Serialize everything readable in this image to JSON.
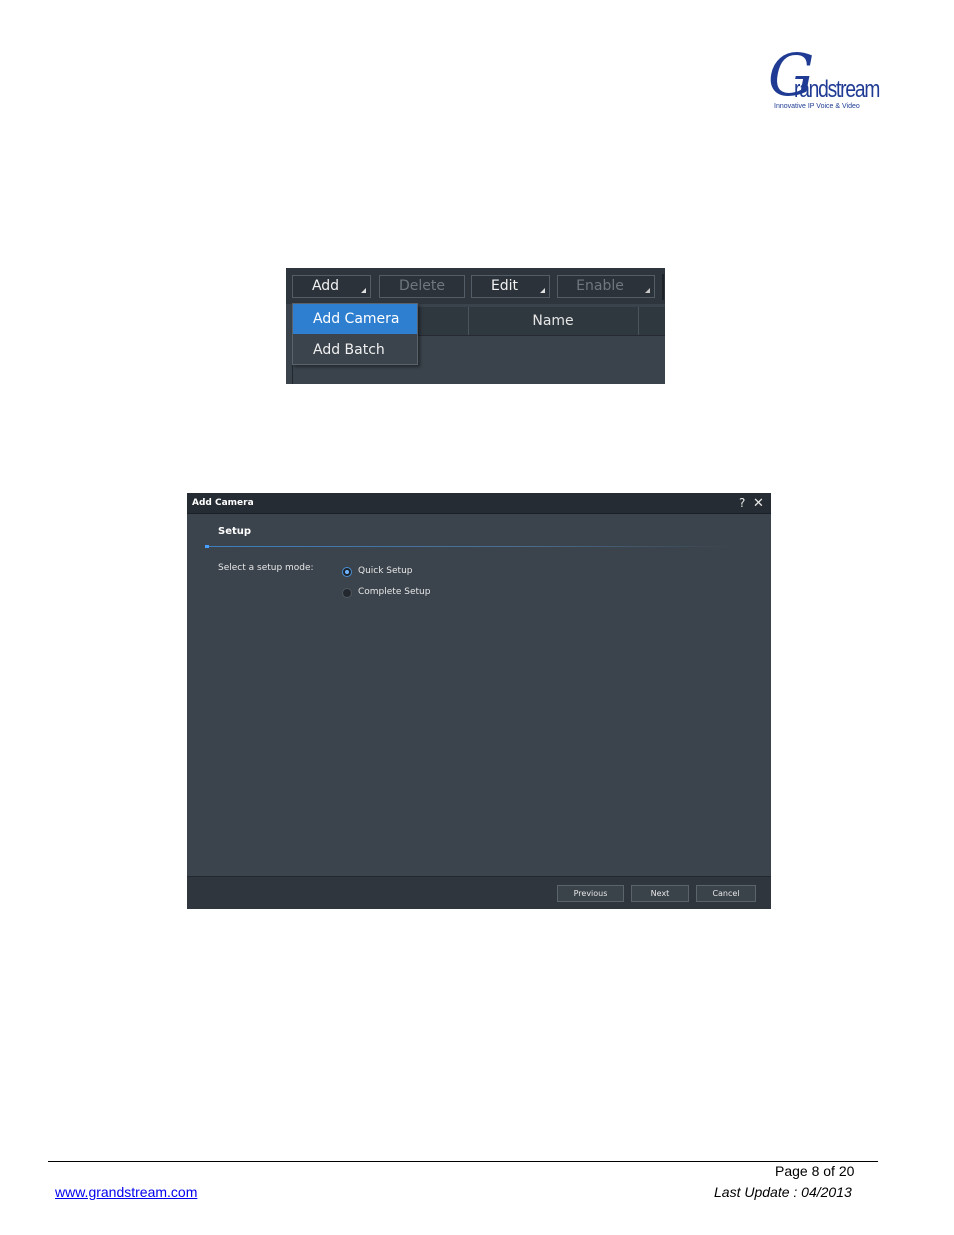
{
  "logo": {
    "letter": "G",
    "wordmark": "randstream",
    "tagline": "Innovative IP Voice & Video"
  },
  "toolbar_screenshot": {
    "buttons": [
      {
        "label": "Add",
        "enabled": true,
        "dropdown": true
      },
      {
        "label": "Delete",
        "enabled": false,
        "dropdown": false
      },
      {
        "label": "Edit",
        "enabled": true,
        "dropdown": true
      },
      {
        "label": "Enable",
        "enabled": false,
        "dropdown": true
      }
    ],
    "column_header": "Name",
    "add_menu": {
      "items": [
        {
          "label": "Add Camera",
          "selected": true
        },
        {
          "label": "Add Batch",
          "selected": false
        }
      ]
    },
    "colors": {
      "highlight": "#2f7fd0",
      "background": "#3a424b"
    }
  },
  "dialog": {
    "title": "Add Camera",
    "help_icon": "?",
    "close_icon": "✕",
    "section_title": "Setup",
    "prompt": "Select a setup mode:",
    "options": [
      {
        "label": "Quick Setup",
        "checked": true
      },
      {
        "label": "Complete Setup",
        "checked": false
      }
    ],
    "buttons": {
      "previous": "Previous",
      "next": "Next",
      "cancel": "Cancel"
    }
  },
  "footer": {
    "page": "Page 8 of 20",
    "url": "www.grandstream.com",
    "last_update": "Last Update : 04/2013"
  }
}
